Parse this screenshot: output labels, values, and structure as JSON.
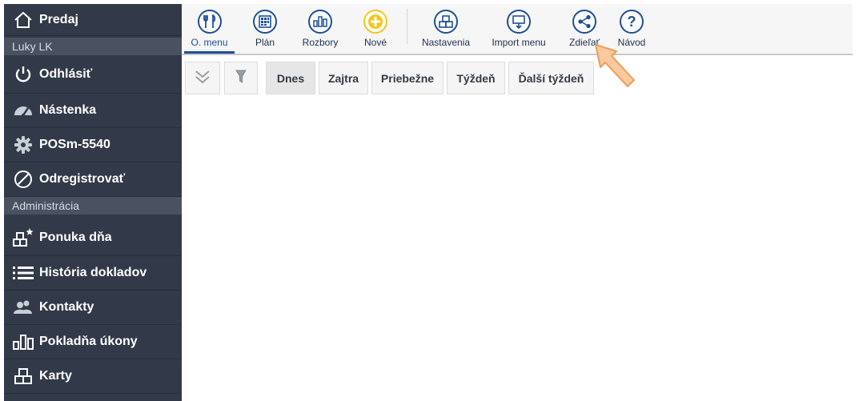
{
  "sidebar": {
    "predaj": "Predaj",
    "user": "Luky LK",
    "odhlasit": "Odhlásiť",
    "nastenka": "Nástenka",
    "pos": "POSm-5540",
    "odregistrovat": "Odregistrovať",
    "admin_header": "Administrácia",
    "ponuka": "Ponuka dňa",
    "historia": "História dokladov",
    "kontakty": "Kontakty",
    "pokladna": "Pokladňa úkony",
    "karty": "Karty"
  },
  "toolbar": {
    "menu": "O. menu",
    "plan": "Plán",
    "rozbory": "Rozbory",
    "nove": "Nové",
    "nastavenia": "Nastavenia",
    "import": "Import menu",
    "zdielat": "Zdieľať",
    "navod": "Návod"
  },
  "filters": {
    "dnes": "Dnes",
    "zajtra": "Zajtra",
    "priebezne": "Priebežne",
    "tyzden": "Týždeň",
    "dalsi": "Ďalší týždeň"
  },
  "colors": {
    "sidebar_bg": "#323a49",
    "accent": "#1d4f96",
    "new_icon": "#f4c61c",
    "pointer": "#f9c9a0"
  },
  "icons": {
    "predaj": "home-icon",
    "odhlasit": "power-icon",
    "nastenka": "dashboard-gauge-icon",
    "pos": "gear-icon",
    "odregistrovat": "prohibited-icon",
    "ponuka": "blocks-star-icon",
    "historia": "list-icon",
    "kontakty": "users-icon",
    "pokladna": "bar-chart-icon",
    "karty": "blocks-icon"
  }
}
